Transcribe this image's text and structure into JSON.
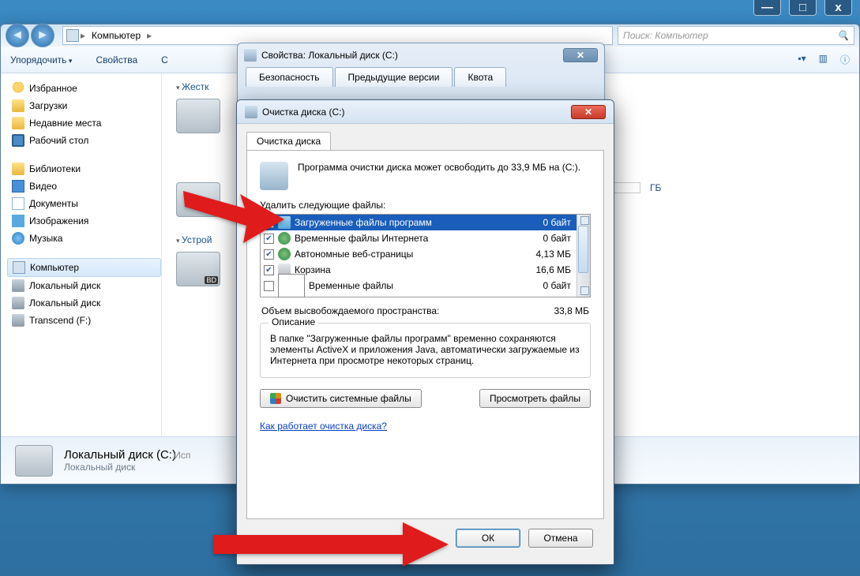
{
  "titlebar": {
    "min": "—",
    "max": "□",
    "close": "x"
  },
  "address": {
    "computer": "Компьютер",
    "sep": "▸"
  },
  "search": {
    "placeholder": "Поиск: Компьютер"
  },
  "toolbar": {
    "organize": "Упорядочить",
    "props": "Свойства",
    "sys": "С"
  },
  "sidebar": {
    "fav": "Избранное",
    "downloads": "Загрузки",
    "recent": "Недавние места",
    "desktop": "Рабочий стол",
    "libs": "Библиотеки",
    "video": "Видео",
    "docs": "Документы",
    "pics": "Изображения",
    "music": "Музыка",
    "computer": "Компьютер",
    "localc": "Локальный диск",
    "locald": "Локальный диск",
    "transcend": "Transcend (F:)"
  },
  "main": {
    "hdd_section": "Жестк",
    "dev_section": "Устрой",
    "tb_label": "ГБ"
  },
  "status": {
    "title": "Локальный диск (C:)",
    "used": "Исп",
    "sub": "Локальный диск"
  },
  "props_dialog": {
    "title": "Свойства: Локальный диск (C:)",
    "tab_security": "Безопасность",
    "tab_prev": "Предыдущие версии",
    "tab_quota": "Квота"
  },
  "cleanup": {
    "title": "Очистка диска  (C:)",
    "tab": "Очистка диска",
    "intro": "Программа очистки диска может освободить до 33,9 МБ на  (C:).",
    "delete_label": "Удалить следующие файлы:",
    "files": [
      {
        "checked": true,
        "icon": "folder",
        "name": "Загруженные файлы программ",
        "size": "0 байт"
      },
      {
        "checked": true,
        "icon": "globe",
        "name": "Временные файлы Интернета",
        "size": "0 байт"
      },
      {
        "checked": true,
        "icon": "globe",
        "name": "Автономные веб-страницы",
        "size": "4,13 МБ"
      },
      {
        "checked": true,
        "icon": "bin",
        "name": "Корзина",
        "size": "16,6 МБ"
      },
      {
        "checked": false,
        "icon": "page",
        "name": "Временные файлы",
        "size": "0 байт"
      }
    ],
    "total_label": "Объем высвобождаемого пространства:",
    "total_value": "33,8 МБ",
    "desc_legend": "Описание",
    "desc_text": "В папке \"Загруженные файлы программ\" временно сохраняются элементы ActiveX и приложения Java, автоматически загружаемые из Интернета при просмотре некоторых страниц.",
    "btn_system": "Очистить системные файлы",
    "btn_view": "Просмотреть файлы",
    "link": "Как работает очистка диска?",
    "ok": "ОК",
    "cancel": "Отмена"
  }
}
